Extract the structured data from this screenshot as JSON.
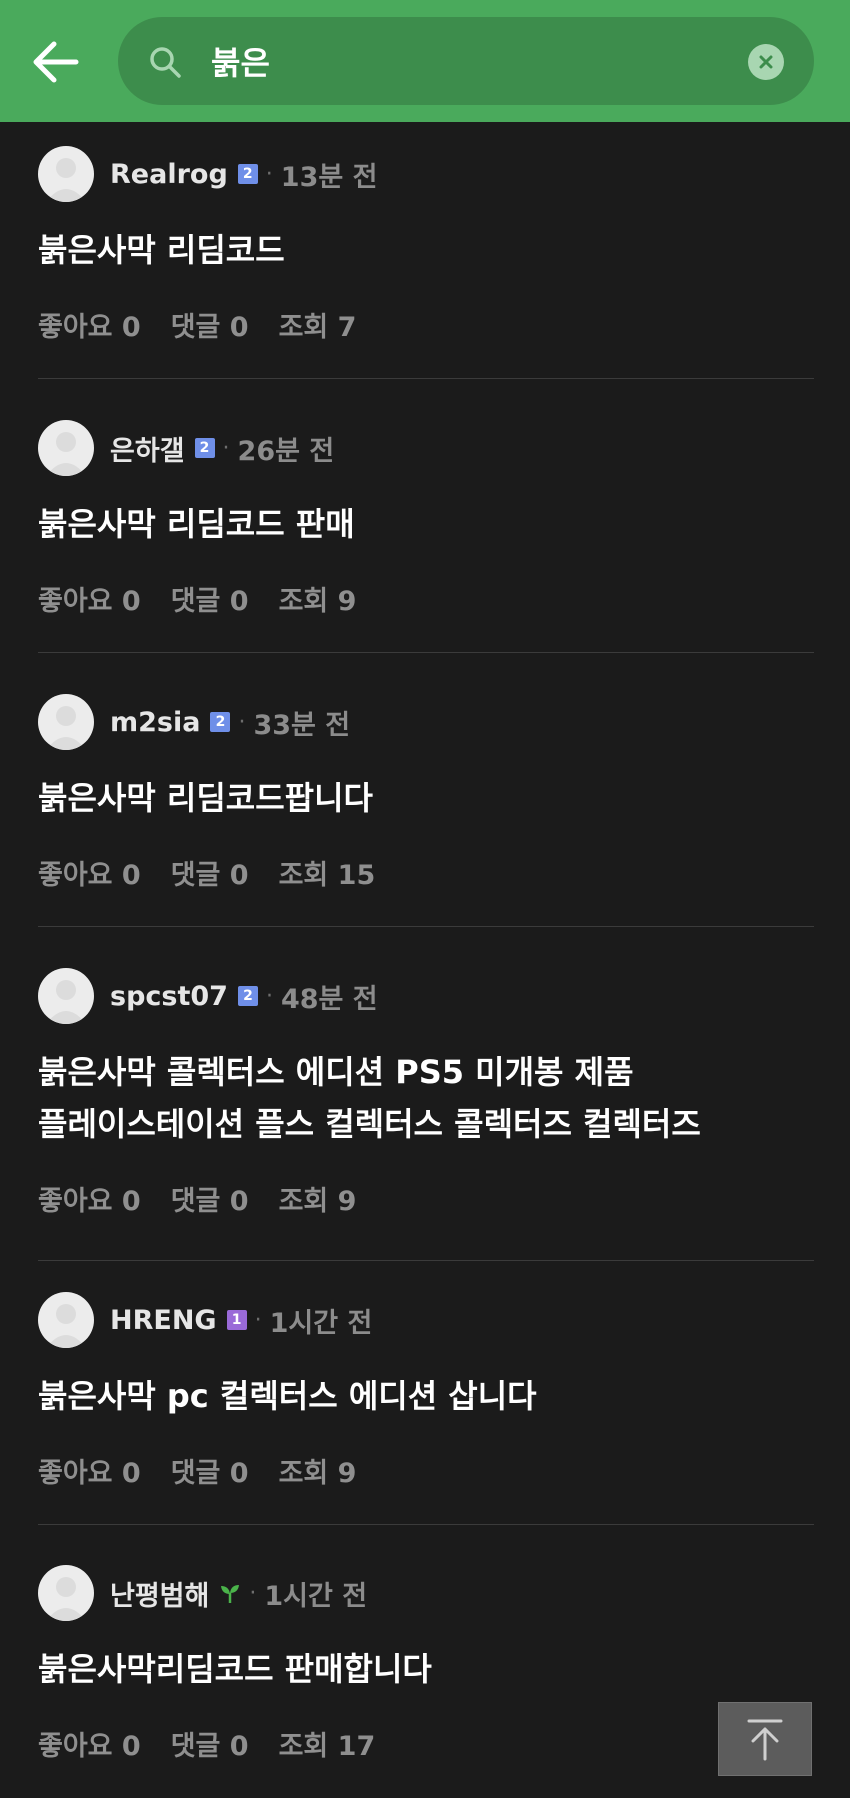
{
  "header": {
    "search_value": "붉은",
    "back_icon": "arrow-left-icon",
    "search_icon": "search-icon",
    "clear_icon": "close-circle-icon"
  },
  "colors": {
    "header_bg": "#4aaa5c",
    "search_bg": "#3d8d4c",
    "badge_level2": "#6f8fe8",
    "badge_level1": "#9a6ad8",
    "sprout": "#4ab34a"
  },
  "posts": [
    {
      "author": "Realrog",
      "badge": "2",
      "badge_type": "level2",
      "time": "13분 전",
      "title_lines": [
        "붉은사막 리딤코드"
      ],
      "likes": "좋아요 0",
      "comments": "댓글 0",
      "views": "조회 7"
    },
    {
      "author": "은하갤",
      "badge": "2",
      "badge_type": "level2",
      "time": "26분 전",
      "title_lines": [
        "붉은사막 리딤코드 판매"
      ],
      "likes": "좋아요 0",
      "comments": "댓글 0",
      "views": "조회 9"
    },
    {
      "author": "m2sia",
      "badge": "2",
      "badge_type": "level2",
      "time": "33분 전",
      "title_lines": [
        "붉은사막 리딤코드팝니다"
      ],
      "likes": "좋아요 0",
      "comments": "댓글 0",
      "views": "조회 15"
    },
    {
      "author": "spcst07",
      "badge": "2",
      "badge_type": "level2",
      "time": "48분 전",
      "title_lines": [
        "붉은사막 콜렉터스 에디션 PS5 미개봉 제품",
        "플레이스테이션 플스 컬렉터스 콜렉터즈 컬렉터즈"
      ],
      "likes": "좋아요 0",
      "comments": "댓글 0",
      "views": "조회 9"
    },
    {
      "author": "HRENG",
      "badge": "1",
      "badge_type": "level1",
      "time": "1시간 전",
      "title_lines": [
        "붉은사막 pc 컬렉터스 에디션 삽니다"
      ],
      "likes": "좋아요 0",
      "comments": "댓글 0",
      "views": "조회 9"
    },
    {
      "author": "난평범해",
      "badge": "",
      "badge_type": "sprout",
      "time": "1시간 전",
      "title_lines": [
        "붉은사막리딤코드 판매합니다"
      ],
      "likes": "좋아요 0",
      "comments": "댓글 0",
      "views": "조회 17"
    }
  ],
  "scroll_top_icon": "arrow-up-icon"
}
